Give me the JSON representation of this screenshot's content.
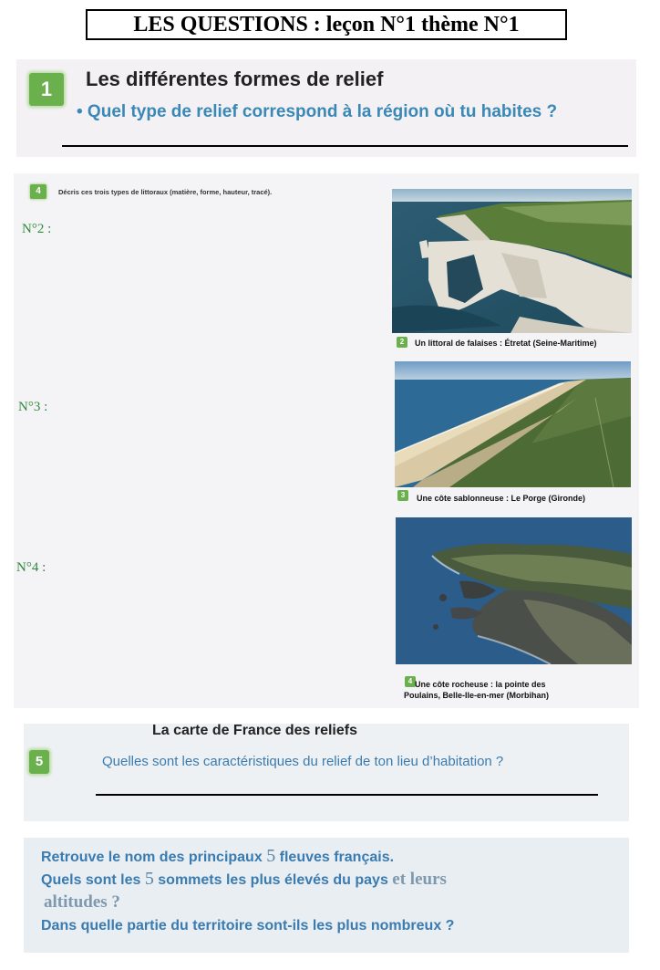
{
  "title": "LES QUESTIONS : leçon N°1 thème N°1",
  "section1": {
    "badge": "1",
    "heading": "Les différentes formes de relief",
    "question": "• Quel type de relief correspond à la région où tu habites ?"
  },
  "section4": {
    "badge": "4",
    "instruction": "Décris ces trois types de littoraux (matière, forme, hauteur, tracé).",
    "labels": [
      "N°2 :",
      "N°3 :",
      "N°4 :"
    ],
    "photos": [
      {
        "badge": "2",
        "caption": "Un littoral de falaises : Étretat (Seine-Maritime)"
      },
      {
        "badge": "3",
        "caption": "Une côte sablonneuse : Le Porge (Gironde)"
      },
      {
        "badge": "4",
        "caption_line1": "Une côte rocheuse : la pointe des",
        "caption_line2": "Poulains, Belle-Ile-en-mer (Morbihan)"
      }
    ]
  },
  "section5": {
    "heading": "La carte de France des reliefs",
    "badge": "5",
    "question": "Quelles sont les caractéristiques du relief de ton lieu d’habitation ?"
  },
  "section6": {
    "line1_a": "Retrouve le nom des principaux",
    "line1_num": "5",
    "line1_b": "fleuves français.",
    "line2_a": "Quels sont les",
    "line2_num": "5",
    "line2_b": "sommets  les plus élevés du pays",
    "line2_c": "et leurs",
    "line3": "altitudes ?",
    "line4_a": "Dans quelle partie du territoire sont-ils",
    "line4_b": "les plus nombreux ?"
  }
}
